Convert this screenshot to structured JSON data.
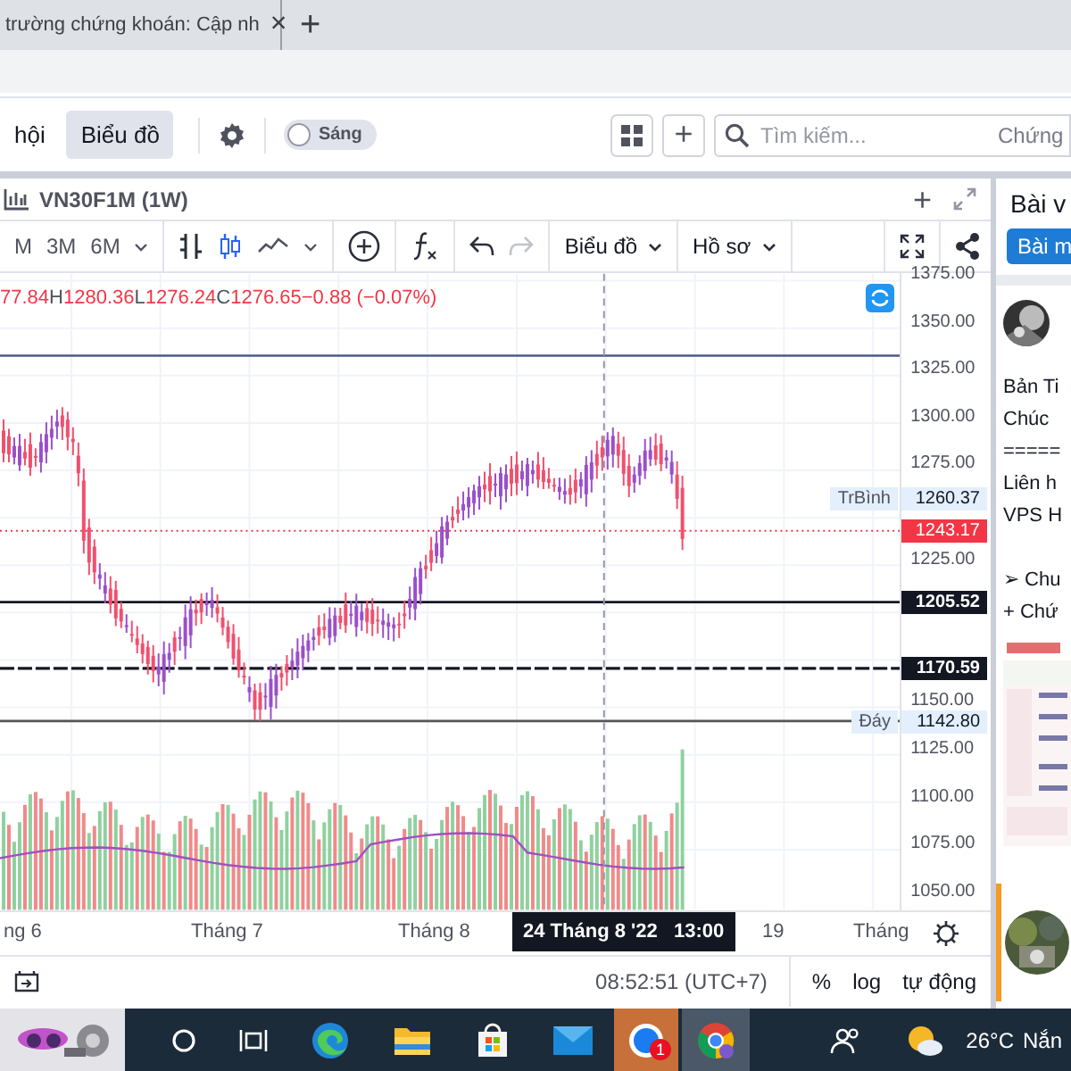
{
  "browser": {
    "tab": {
      "title": "trường chứng khoán: Cập nh",
      "close": "×"
    },
    "new_tab": "+"
  },
  "app_bar": {
    "nav_items": [
      {
        "label": "hội",
        "selected": false
      },
      {
        "label": "Biểu đồ",
        "selected": true
      }
    ],
    "theme_toggle": {
      "label": "Sáng",
      "on": false
    },
    "add_button": "+",
    "search": {
      "placeholder": "Tìm kiếm..."
    },
    "nav_right": "Chứng"
  },
  "chart_panel": {
    "title": "VN30F1M (1W)",
    "add": "+",
    "intervals": [
      "M",
      "3M",
      "6M"
    ],
    "menus": [
      "Biểu đồ",
      "Hồ sơ"
    ],
    "legend": {
      "open": "77.84",
      "values": [
        {
          "label": "H",
          "value": "1280.36"
        },
        {
          "label": "L",
          "value": "1276.24"
        },
        {
          "label": "C",
          "value": "1276.65"
        }
      ],
      "change": "−0.88 (−0.07%)"
    },
    "y_ticks": [
      "1375.00",
      "1350.00",
      "1325.00",
      "1300.00",
      "1275.00",
      "1225.00",
      "1150.00",
      "1125.00",
      "1100.00",
      "1075.00",
      "1050.00"
    ],
    "price_tags": [
      {
        "label": "TrBình",
        "value": "1260.37",
        "kind": "soft"
      },
      {
        "value": "1243.17",
        "kind": "last"
      },
      {
        "value": "1205.52",
        "kind": "dark"
      },
      {
        "value": "1170.59",
        "kind": "dark"
      },
      {
        "label": "Đáy",
        "value": "1142.80",
        "kind": "soft"
      }
    ],
    "x_labels": [
      "ng 6",
      "Tháng 7",
      "Tháng 8",
      "19",
      "Tháng"
    ],
    "crosshair": {
      "date": "24 Tháng 8 '22",
      "time": "13:00"
    },
    "status": {
      "time": "08:52:51 (UTC+7)",
      "options": [
        "%",
        "log",
        "tự động"
      ]
    }
  },
  "sidebar": {
    "tab": "Bài v",
    "button": "Bài m",
    "post_blocks": [
      [
        "Bản Ti",
        "Chúc",
        "=====",
        "Liên h",
        "VPS H"
      ],
      [
        "➢ Chu",
        "+ Chứ"
      ]
    ]
  },
  "taskbar": {
    "chat_badge": "1",
    "temperature": "26°C",
    "weather": "Nắn"
  }
}
